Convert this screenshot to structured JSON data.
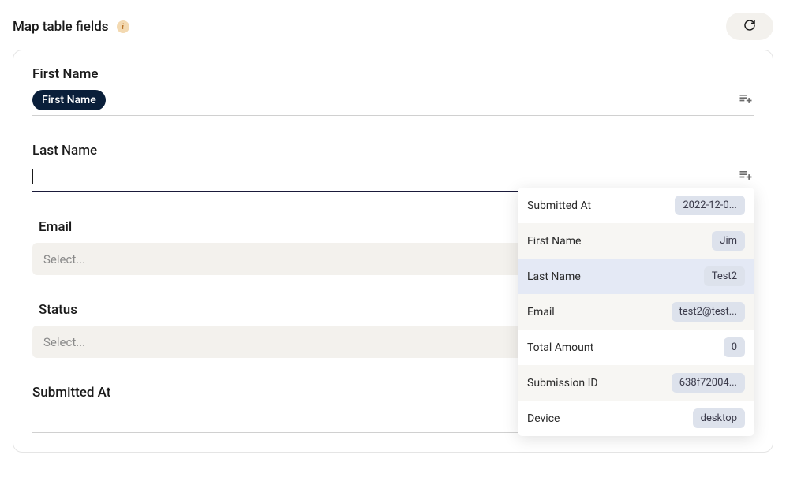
{
  "header": {
    "title": "Map table fields"
  },
  "fields": {
    "first_name": {
      "label": "First Name",
      "chip": "First Name"
    },
    "last_name": {
      "label": "Last Name",
      "value": ""
    },
    "email": {
      "label": "Email",
      "placeholder": "Select..."
    },
    "status": {
      "label": "Status",
      "placeholder": "Select..."
    },
    "submitted_at": {
      "label": "Submitted At"
    }
  },
  "dropdown": {
    "items": [
      {
        "label": "Submitted At",
        "value": "2022-12-0..."
      },
      {
        "label": "First Name",
        "value": "Jim"
      },
      {
        "label": "Last Name",
        "value": "Test2"
      },
      {
        "label": "Email",
        "value": "test2@test..."
      },
      {
        "label": "Total Amount",
        "value": "0"
      },
      {
        "label": "Submission ID",
        "value": "638f72004..."
      },
      {
        "label": "Device",
        "value": "desktop"
      }
    ]
  }
}
